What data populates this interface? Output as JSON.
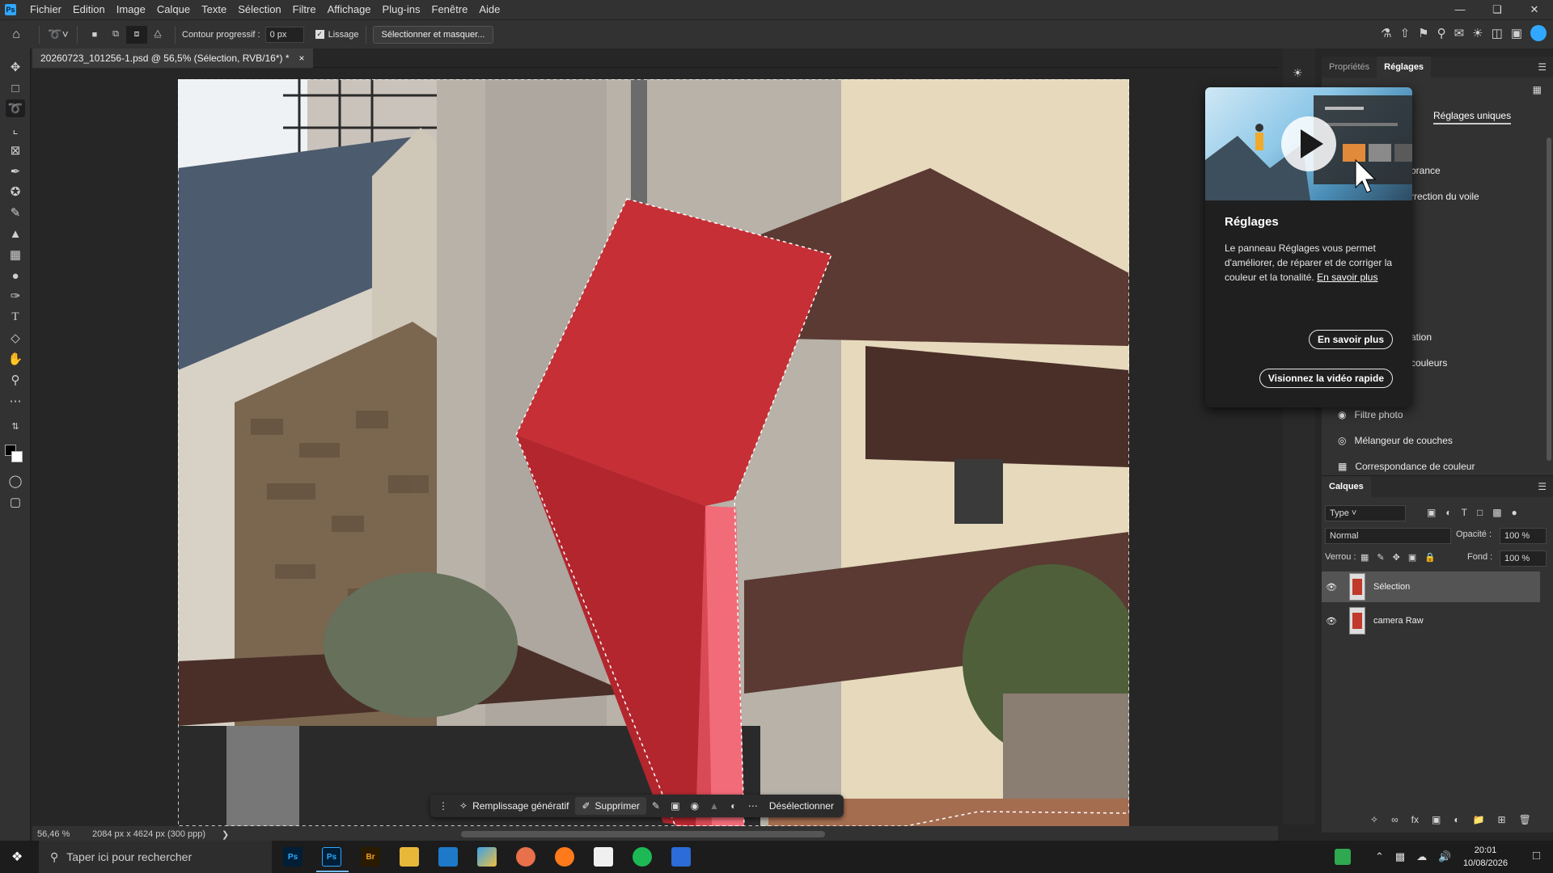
{
  "menubar": {
    "items": [
      "Fichier",
      "Edition",
      "Image",
      "Calque",
      "Texte",
      "Sélection",
      "Filtre",
      "Affichage",
      "Plug-ins",
      "Fenêtre",
      "Aide"
    ]
  },
  "options": {
    "feather_label": "Contour progressif :",
    "feather_value": "0 px",
    "antialias_label": "Lissage",
    "select_mask_button": "Sélectionner et masquer..."
  },
  "document": {
    "tab_title": "20260723_101256-1.psd @ 56,5% (Sélection, RVB/16*) *",
    "close_glyph": "×"
  },
  "status": {
    "zoom": "56,46 %",
    "dimensions": "2084 px x 4624 px (300 ppp)"
  },
  "contextual_bar": {
    "generative_fill": "Remplissage génératif",
    "delete": "Supprimer",
    "deselect": "Désélectionner"
  },
  "right_panel": {
    "tabs": [
      "Propriétés",
      "Réglages"
    ],
    "active_tab": "Réglages",
    "subtab": "Réglages uniques",
    "partial_items": [
      "brance",
      "rrection du voile",
      "ation",
      "couleurs"
    ],
    "items": [
      "Filtre photo",
      "Mélangeur de couches",
      "Correspondance de couleur"
    ]
  },
  "popup": {
    "title": "Réglages",
    "body": "Le panneau Réglages vous permet d'améliorer, de réparer et de corriger la couleur et la tonalité.",
    "link": "En savoir plus",
    "button_learn": "En savoir plus",
    "button_video": "Visionnez la vidéo rapide"
  },
  "layers_panel": {
    "title": "Calques",
    "filter": "Type",
    "blend_mode": "Normal",
    "opacity_label": "Opacité :",
    "opacity_value": "100 %",
    "lock_label": "Verrou :",
    "fill_label": "Fond :",
    "fill_value": "100 %",
    "layers": [
      {
        "name": "Sélection",
        "selected": true
      },
      {
        "name": "camera Raw",
        "selected": false
      }
    ]
  },
  "taskbar": {
    "search_placeholder": "Taper ici pour rechercher",
    "time": "20:01",
    "date": "10/08/2026",
    "apps": [
      "Ps",
      "Ps",
      "Br"
    ]
  },
  "colors": {
    "accent": "#31a8ff",
    "sculpture_red": "#c62f35",
    "panel_bg": "#323232"
  }
}
